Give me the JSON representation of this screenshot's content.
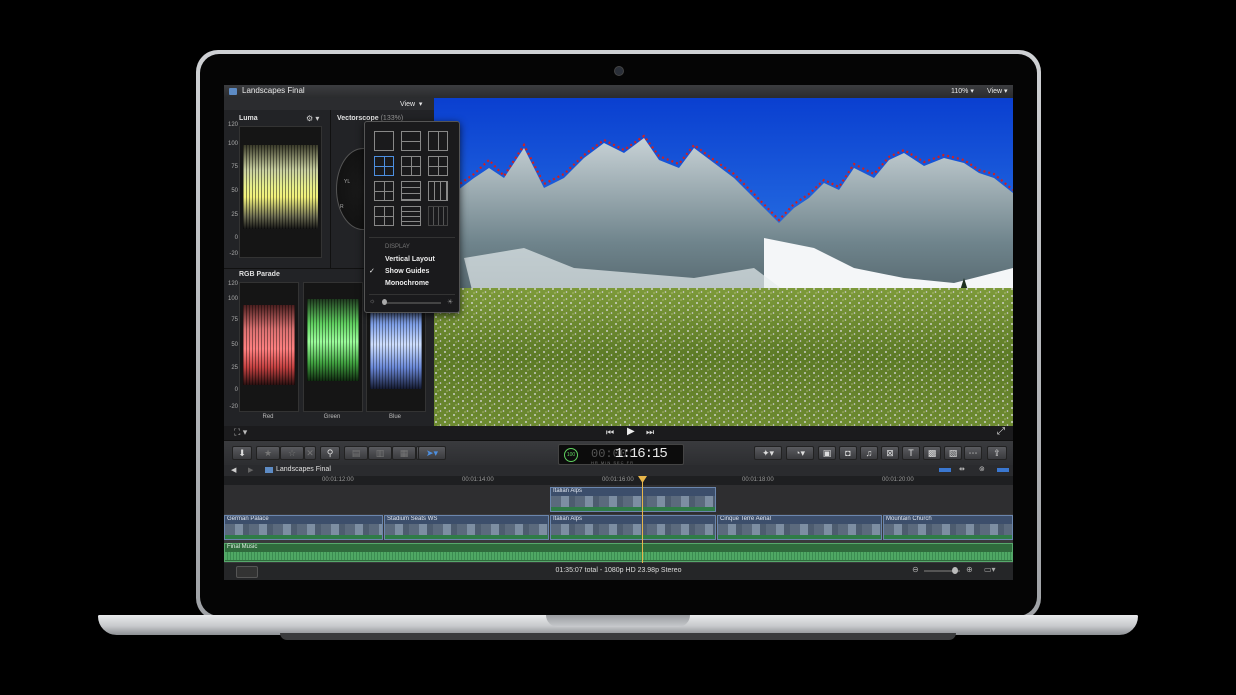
{
  "window": {
    "title": "Landscapes Final",
    "zoom": "110%",
    "view_menu": "View"
  },
  "scopes": {
    "view_label": "View",
    "luma": {
      "title": "Luma",
      "ticks": [
        "120",
        "100",
        "75",
        "50",
        "25",
        "0",
        "-20"
      ]
    },
    "vectorscope": {
      "title": "Vectorscope",
      "zoom": "(133%)",
      "markers": [
        "YL",
        "R"
      ]
    },
    "rgb_parade": {
      "title": "RGB Parade",
      "ticks": [
        "120",
        "100",
        "75",
        "50",
        "25",
        "0",
        "-20"
      ],
      "channels": [
        "Red",
        "Green",
        "Blue"
      ]
    }
  },
  "view_popup": {
    "section": "DISPLAY",
    "items": [
      {
        "label": "Vertical Layout",
        "checked": false
      },
      {
        "label": "Show Guides",
        "checked": true
      },
      {
        "label": "Monochrome",
        "checked": false
      }
    ]
  },
  "toolbar": {
    "timecode": "1:16:15",
    "timecode_prefix": "00:00:",
    "timecode_units": "HR MIN SEC FR",
    "percent": "100",
    "title_icon_label": "T"
  },
  "timeline": {
    "project": "Landscapes Final",
    "ruler": [
      "00:01:12:00",
      "00:01:14:00",
      "00:01:16:00",
      "00:01:18:00",
      "00:01:20:00"
    ],
    "connected_clip": "Italian Alps",
    "primary_clips": [
      "German Palace",
      "Stadium Seats WS",
      "Italian Alps",
      "Cinque Terre Aerial",
      "Mountain Church"
    ],
    "audio_clip": "Final Music"
  },
  "status": {
    "text": "01:35:07 total - 1080p HD 23.98p Stereo"
  },
  "colors": {
    "accent": "#4d8fe0",
    "playhead": "#e8b64a",
    "audio": "#2f6b3c",
    "clip": "#3c4e6b"
  }
}
